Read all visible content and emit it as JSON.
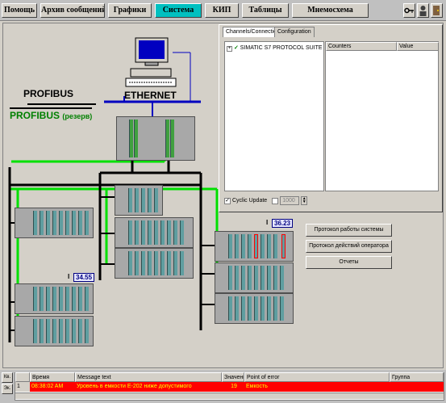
{
  "menu": {
    "items": [
      {
        "label": "Помощь",
        "active": false
      },
      {
        "label": "Архив сообщений",
        "active": false
      },
      {
        "label": "Графики",
        "active": false
      },
      {
        "label": "Система",
        "active": true
      },
      {
        "label": "КИП",
        "active": false
      },
      {
        "label": "Таблицы",
        "active": false
      },
      {
        "label": "Мнемосхема",
        "active": false
      }
    ]
  },
  "network": {
    "profibus": "PROFIBUS",
    "profibus_reserve": "PROFIBUS",
    "profibus_reserve_suffix": "(резерв)",
    "ethernet": "ETHERNET"
  },
  "readouts": {
    "r1_prefix": "I",
    "r1_value": "34.55",
    "r2_prefix": "I",
    "r2_value": "36.23"
  },
  "config_window": {
    "tabs": [
      "Channels/Connections",
      "Configuration"
    ],
    "tree_item": "SIMATIC S7 PROTOCOL SUITE",
    "columns": [
      "Counters",
      "Value"
    ],
    "cyclic_update_label": "Cyclic Update",
    "cyclic_update_checked": true,
    "interval_value": "1000"
  },
  "buttons": {
    "system_log": "Протокол работы системы",
    "operator_log": "Протокол действий оператора",
    "reports": "Отчеты"
  },
  "alarms": {
    "side_buttons": [
      "Кв.",
      "Эк."
    ],
    "columns": [
      "",
      "Время",
      "Message text",
      "Значени",
      "Point of error",
      "Группа"
    ],
    "rows": [
      {
        "num": "1",
        "time": "08:38:02 AM",
        "message": "Уровень    в емкости Е-202  ниже допустимого",
        "value": "19",
        "point": "Емкость",
        "group": ""
      }
    ]
  },
  "colors": {
    "active_menu": "#00c0c0",
    "alarm_bg": "#ff0000",
    "alarm_text": "#ffff00",
    "profibus_green": "#00e000",
    "ethernet_blue": "#0000c0"
  }
}
